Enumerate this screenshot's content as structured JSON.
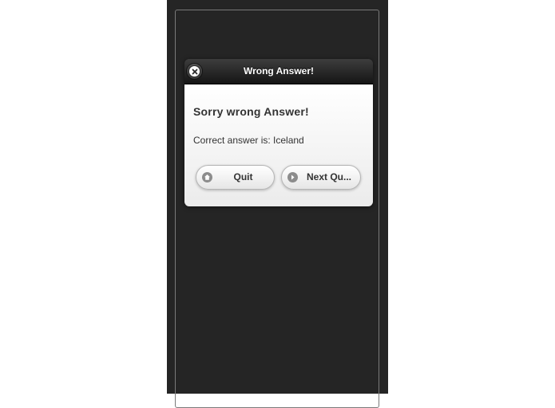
{
  "dialog": {
    "title": "Wrong Answer!",
    "close_icon": "close-icon",
    "heading": "Sorry wrong Answer!",
    "message": "Correct answer is: Iceland",
    "buttons": {
      "quit_label": "Quit",
      "quit_icon": "home-icon",
      "next_label": "Next Qu...",
      "next_icon": "arrow-right-icon"
    }
  },
  "colors": {
    "phone_background": "#252525",
    "header_background": "#1e1e1e",
    "body_background": "#f5f5f5",
    "text": "#333333"
  }
}
